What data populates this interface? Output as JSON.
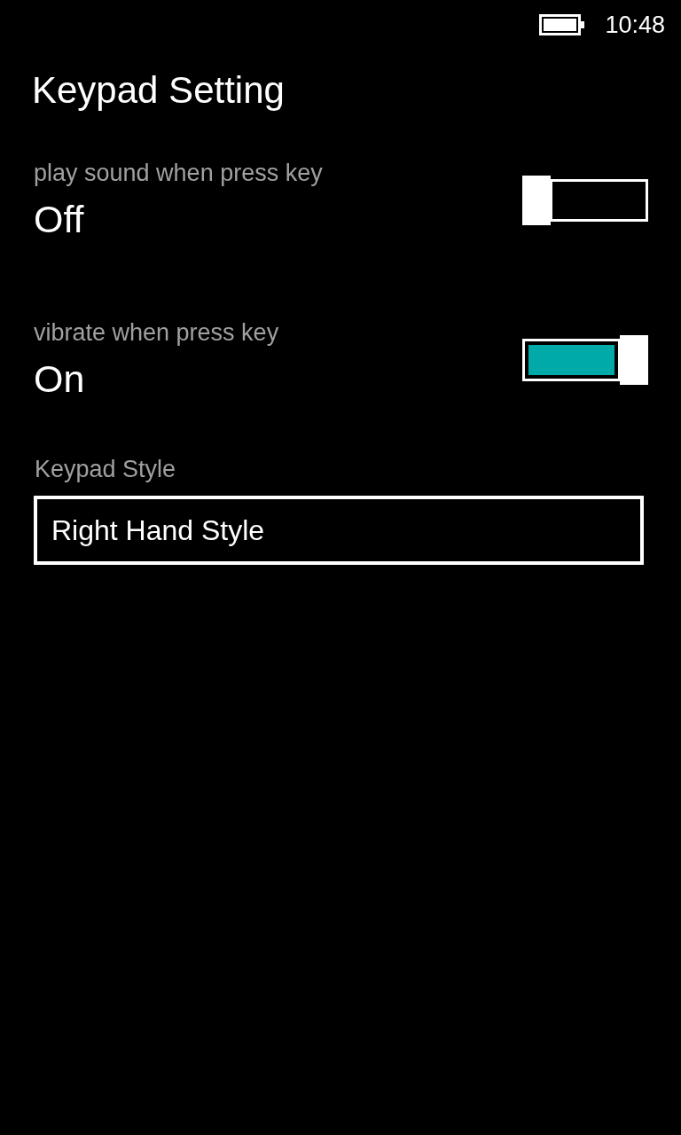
{
  "status_bar": {
    "time": "10:48"
  },
  "title": "Keypad Setting",
  "toggles": [
    {
      "label": "play sound when press key",
      "value": "Off",
      "on": false
    },
    {
      "label": "vibrate when press key",
      "value": "On",
      "on": true
    }
  ],
  "keypad_style": {
    "label": "Keypad Style",
    "value": "Right Hand Style"
  }
}
